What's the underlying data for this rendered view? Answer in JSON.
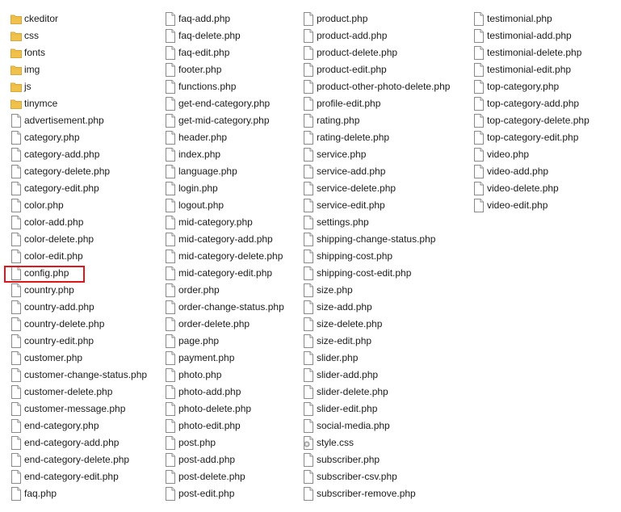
{
  "columns": [
    {
      "items": [
        {
          "name": "ckeditor",
          "icon": "folder-icon"
        },
        {
          "name": "css",
          "icon": "folder-icon"
        },
        {
          "name": "fonts",
          "icon": "folder-icon"
        },
        {
          "name": "img",
          "icon": "folder-icon"
        },
        {
          "name": "js",
          "icon": "folder-icon"
        },
        {
          "name": "tinymce",
          "icon": "folder-icon"
        },
        {
          "name": "advertisement.php",
          "icon": "file-icon"
        },
        {
          "name": "category.php",
          "icon": "file-icon"
        },
        {
          "name": "category-add.php",
          "icon": "file-icon"
        },
        {
          "name": "category-delete.php",
          "icon": "file-icon"
        },
        {
          "name": "category-edit.php",
          "icon": "file-icon"
        },
        {
          "name": "color.php",
          "icon": "file-icon"
        },
        {
          "name": "color-add.php",
          "icon": "file-icon"
        },
        {
          "name": "color-delete.php",
          "icon": "file-icon"
        },
        {
          "name": "color-edit.php",
          "icon": "file-icon"
        },
        {
          "name": "config.php",
          "icon": "file-icon",
          "highlighted": true
        },
        {
          "name": "country.php",
          "icon": "file-icon"
        },
        {
          "name": "country-add.php",
          "icon": "file-icon"
        },
        {
          "name": "country-delete.php",
          "icon": "file-icon"
        },
        {
          "name": "country-edit.php",
          "icon": "file-icon"
        },
        {
          "name": "customer.php",
          "icon": "file-icon"
        },
        {
          "name": "customer-change-status.php",
          "icon": "file-icon"
        },
        {
          "name": "customer-delete.php",
          "icon": "file-icon"
        },
        {
          "name": "customer-message.php",
          "icon": "file-icon"
        },
        {
          "name": "end-category.php",
          "icon": "file-icon"
        },
        {
          "name": "end-category-add.php",
          "icon": "file-icon"
        },
        {
          "name": "end-category-delete.php",
          "icon": "file-icon"
        },
        {
          "name": "end-category-edit.php",
          "icon": "file-icon"
        },
        {
          "name": "faq.php",
          "icon": "file-icon"
        }
      ]
    },
    {
      "items": [
        {
          "name": "faq-add.php",
          "icon": "file-icon"
        },
        {
          "name": "faq-delete.php",
          "icon": "file-icon"
        },
        {
          "name": "faq-edit.php",
          "icon": "file-icon"
        },
        {
          "name": "footer.php",
          "icon": "file-icon"
        },
        {
          "name": "functions.php",
          "icon": "file-icon"
        },
        {
          "name": "get-end-category.php",
          "icon": "file-icon"
        },
        {
          "name": "get-mid-category.php",
          "icon": "file-icon"
        },
        {
          "name": "header.php",
          "icon": "file-icon"
        },
        {
          "name": "index.php",
          "icon": "file-icon"
        },
        {
          "name": "language.php",
          "icon": "file-icon"
        },
        {
          "name": "login.php",
          "icon": "file-icon"
        },
        {
          "name": "logout.php",
          "icon": "file-icon"
        },
        {
          "name": "mid-category.php",
          "icon": "file-icon"
        },
        {
          "name": "mid-category-add.php",
          "icon": "file-icon"
        },
        {
          "name": "mid-category-delete.php",
          "icon": "file-icon"
        },
        {
          "name": "mid-category-edit.php",
          "icon": "file-icon"
        },
        {
          "name": "order.php",
          "icon": "file-icon"
        },
        {
          "name": "order-change-status.php",
          "icon": "file-icon"
        },
        {
          "name": "order-delete.php",
          "icon": "file-icon"
        },
        {
          "name": "page.php",
          "icon": "file-icon"
        },
        {
          "name": "payment.php",
          "icon": "file-icon"
        },
        {
          "name": "photo.php",
          "icon": "file-icon"
        },
        {
          "name": "photo-add.php",
          "icon": "file-icon"
        },
        {
          "name": "photo-delete.php",
          "icon": "file-icon"
        },
        {
          "name": "photo-edit.php",
          "icon": "file-icon"
        },
        {
          "name": "post.php",
          "icon": "file-icon"
        },
        {
          "name": "post-add.php",
          "icon": "file-icon"
        },
        {
          "name": "post-delete.php",
          "icon": "file-icon"
        },
        {
          "name": "post-edit.php",
          "icon": "file-icon"
        }
      ]
    },
    {
      "items": [
        {
          "name": "product.php",
          "icon": "file-icon"
        },
        {
          "name": "product-add.php",
          "icon": "file-icon"
        },
        {
          "name": "product-delete.php",
          "icon": "file-icon"
        },
        {
          "name": "product-edit.php",
          "icon": "file-icon"
        },
        {
          "name": "product-other-photo-delete.php",
          "icon": "file-icon"
        },
        {
          "name": "profile-edit.php",
          "icon": "file-icon"
        },
        {
          "name": "rating.php",
          "icon": "file-icon"
        },
        {
          "name": "rating-delete.php",
          "icon": "file-icon"
        },
        {
          "name": "service.php",
          "icon": "file-icon"
        },
        {
          "name": "service-add.php",
          "icon": "file-icon"
        },
        {
          "name": "service-delete.php",
          "icon": "file-icon"
        },
        {
          "name": "service-edit.php",
          "icon": "file-icon"
        },
        {
          "name": "settings.php",
          "icon": "file-icon"
        },
        {
          "name": "shipping-change-status.php",
          "icon": "file-icon"
        },
        {
          "name": "shipping-cost.php",
          "icon": "file-icon"
        },
        {
          "name": "shipping-cost-edit.php",
          "icon": "file-icon"
        },
        {
          "name": "size.php",
          "icon": "file-icon"
        },
        {
          "name": "size-add.php",
          "icon": "file-icon"
        },
        {
          "name": "size-delete.php",
          "icon": "file-icon"
        },
        {
          "name": "size-edit.php",
          "icon": "file-icon"
        },
        {
          "name": "slider.php",
          "icon": "file-icon"
        },
        {
          "name": "slider-add.php",
          "icon": "file-icon"
        },
        {
          "name": "slider-delete.php",
          "icon": "file-icon"
        },
        {
          "name": "slider-edit.php",
          "icon": "file-icon"
        },
        {
          "name": "social-media.php",
          "icon": "file-icon"
        },
        {
          "name": "style.css",
          "icon": "css-file-icon"
        },
        {
          "name": "subscriber.php",
          "icon": "file-icon"
        },
        {
          "name": "subscriber-csv.php",
          "icon": "file-icon"
        },
        {
          "name": "subscriber-remove.php",
          "icon": "file-icon"
        }
      ]
    },
    {
      "items": [
        {
          "name": "testimonial.php",
          "icon": "file-icon"
        },
        {
          "name": "testimonial-add.php",
          "icon": "file-icon"
        },
        {
          "name": "testimonial-delete.php",
          "icon": "file-icon"
        },
        {
          "name": "testimonial-edit.php",
          "icon": "file-icon"
        },
        {
          "name": "top-category.php",
          "icon": "file-icon"
        },
        {
          "name": "top-category-add.php",
          "icon": "file-icon"
        },
        {
          "name": "top-category-delete.php",
          "icon": "file-icon"
        },
        {
          "name": "top-category-edit.php",
          "icon": "file-icon"
        },
        {
          "name": "video.php",
          "icon": "file-icon"
        },
        {
          "name": "video-add.php",
          "icon": "file-icon"
        },
        {
          "name": "video-delete.php",
          "icon": "file-icon"
        },
        {
          "name": "video-edit.php",
          "icon": "file-icon"
        }
      ]
    }
  ],
  "colors": {
    "folder": "#f0c24b",
    "folder_dark": "#d9a73a",
    "file_border": "#8a8a8a",
    "highlight_border": "#e0161a",
    "text": "#1b1b1b"
  }
}
